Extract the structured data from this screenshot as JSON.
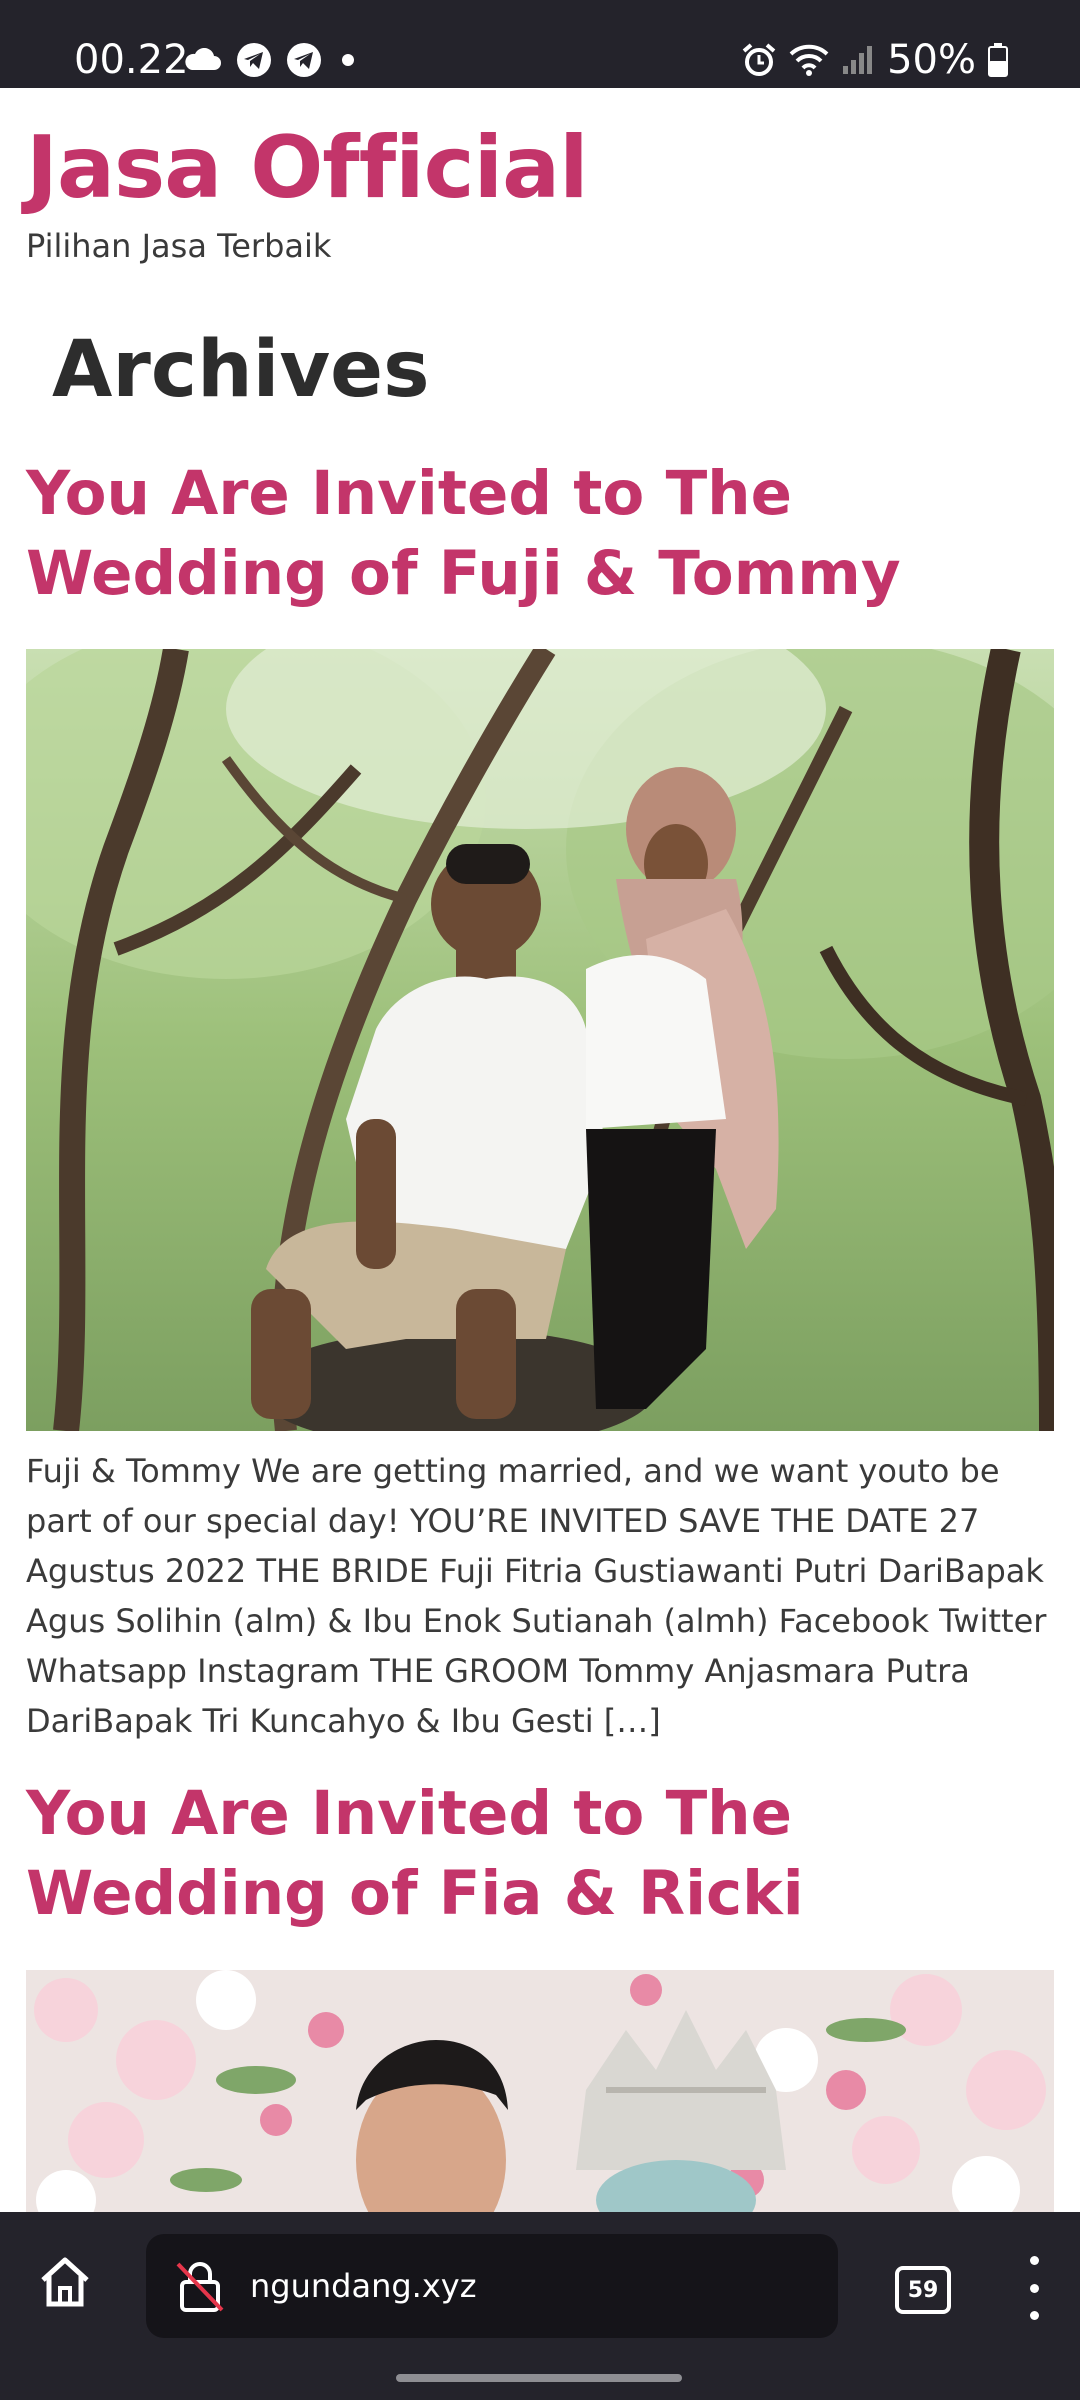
{
  "status_bar": {
    "time": "00.22",
    "left_icons": [
      "cloud-icon",
      "telegram-icon",
      "telegram-icon",
      "dot-icon"
    ],
    "right_icons": [
      "alarm-icon",
      "wifi-icon",
      "signal-icon",
      "battery-icon"
    ],
    "battery": "50%"
  },
  "site": {
    "title": "Jasa Official",
    "tagline": "Pilihan Jasa Terbaik"
  },
  "archive": {
    "heading": "Archives"
  },
  "posts": [
    {
      "title": "You Are Invited to The Wedding of Fuji & Tommy",
      "excerpt": "Fuji & Tommy We are getting married, and we want youto be part of our special day! YOU’RE INVITED SAVE THE DATE 27 Agustus 2022 THE BRIDE Fuji Fitria Gustiawanti Putri DariBapak Agus Solihin (alm) & Ibu Enok Sutianah (almh) Facebook Twitter Whatsapp Instagram THE GROOM Tommy Anjasmara Putra DariBapak Tri Kuncahyo & Ibu Gesti […]",
      "image": "couple-sitting-under-trees-photo"
    },
    {
      "title": "You Are Invited to The Wedding of Fia & Ricki",
      "image": "couple-in-front-of-flower-wall-photo"
    }
  ],
  "browser": {
    "url": "ngundang.xyz",
    "tab_count": "59",
    "home_icon": "home-icon",
    "lock_icon": "not-secure-lock-icon",
    "menu_icon": "more-vertical-icon"
  },
  "colors": {
    "accent": "#c3356a",
    "bar_background": "#24232b"
  }
}
